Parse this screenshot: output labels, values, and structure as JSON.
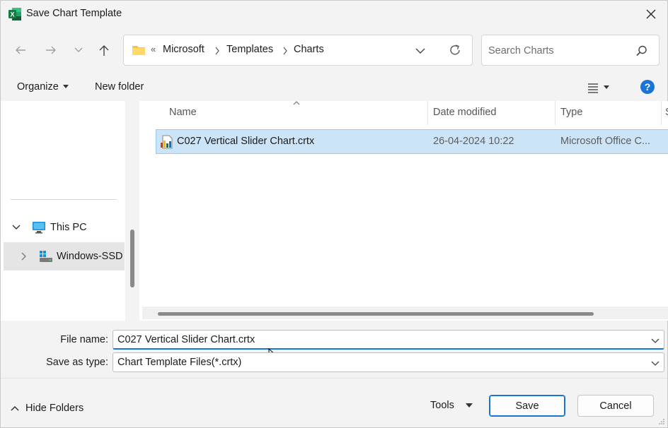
{
  "window": {
    "title": "Save Chart Template",
    "accent": "#1a73d6",
    "selection_color": "#cce4f7"
  },
  "address": {
    "overflow": "«",
    "crumbs": [
      "Microsoft",
      "Templates",
      "Charts"
    ]
  },
  "search": {
    "placeholder": "Search Charts"
  },
  "toolbar": {
    "organize_label": "Organize",
    "new_folder_label": "New folder",
    "help_label": "?"
  },
  "nav": {
    "this_pc": "This PC",
    "drive": "Windows-SSD"
  },
  "columns": {
    "name": "Name",
    "date_modified": "Date modified",
    "type": "Type",
    "size_partial": "S"
  },
  "files": [
    {
      "name": "C027 Vertical Slider Chart.crtx",
      "date": "26-04-2024 10:22",
      "type": "Microsoft Office C..."
    }
  ],
  "form": {
    "file_name_label": "File name:",
    "file_name_value": "C027 Vertical Slider Chart.crtx",
    "save_type_label": "Save as type:",
    "save_type_value": "Chart Template Files(*.crtx)"
  },
  "footer": {
    "hide_folders_label": "Hide Folders",
    "tools_label": "Tools",
    "save_label": "Save",
    "cancel_label": "Cancel"
  }
}
